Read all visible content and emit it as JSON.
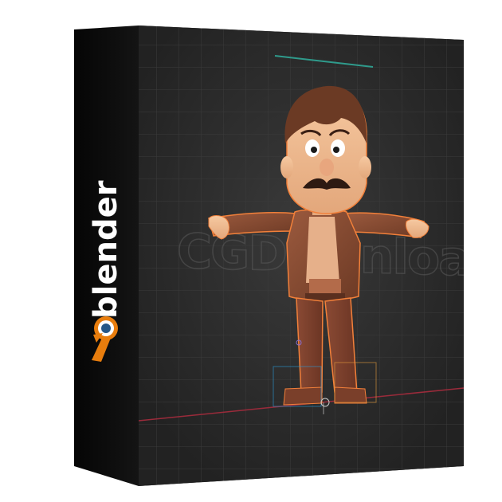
{
  "product": {
    "brand_name": "blender",
    "watermark": "CGDownload"
  },
  "colors": {
    "box_side": "#0b0b0b",
    "box_front": "#2b2b2b",
    "grid_line": "#3a3a3a",
    "brand_orange": "#e87d0d",
    "brand_blue": "#265787",
    "character_rim": "#f2803a"
  },
  "icons": {
    "logo": "blender-logo-icon"
  }
}
